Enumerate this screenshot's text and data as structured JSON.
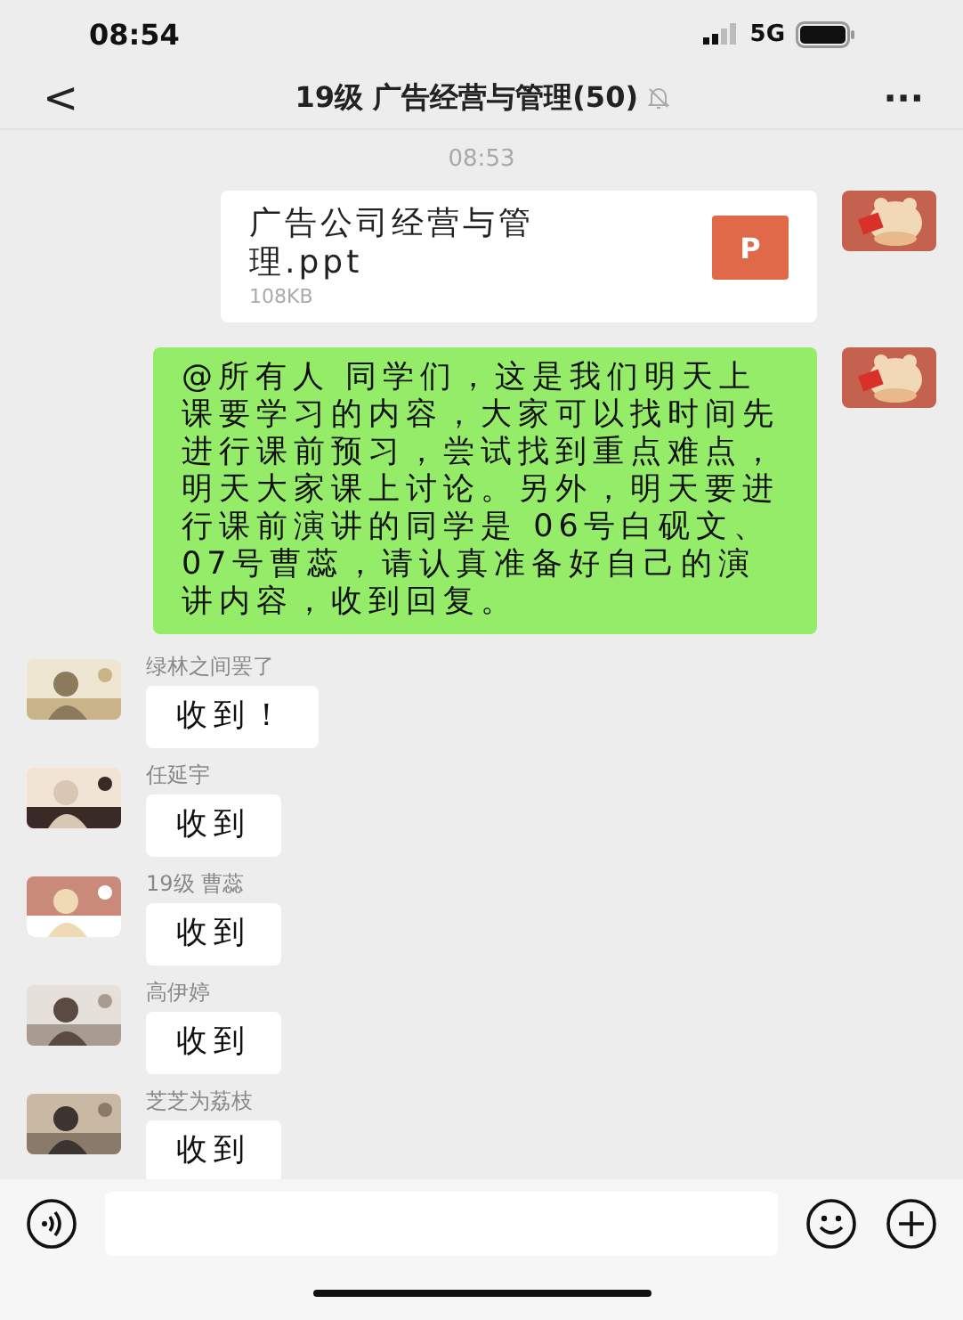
{
  "status_bar": {
    "time": "08:54",
    "network": "5G"
  },
  "nav": {
    "back": "<",
    "title": "19级 广告经营与管理(50)",
    "muted": true,
    "more": "···"
  },
  "timestamp": "08:53",
  "messages": [
    {
      "kind": "file",
      "outgoing": true,
      "file_name": "广告公司经营与管理.ppt",
      "file_size": "108KB",
      "file_icon": "P"
    },
    {
      "kind": "text",
      "outgoing": true,
      "text": "@所有人 同学们，这是我们明天上课要学习的内容，大家可以找时间先进行课前预习，尝试找到重点难点，明天大家课上讨论。另外，明天要进行课前演讲的同学是 06号白砚文、07号曹蕊，请认真准备好自己的演讲内容，收到回复。"
    },
    {
      "kind": "text",
      "outgoing": false,
      "sender": "绿林之间罢了",
      "text": "收到！"
    },
    {
      "kind": "text",
      "outgoing": false,
      "sender": "任延宇",
      "text": "收到"
    },
    {
      "kind": "text",
      "outgoing": false,
      "sender": "19级 曹蕊",
      "text": "收到"
    },
    {
      "kind": "text",
      "outgoing": false,
      "sender": "高伊婷",
      "text": "收到"
    },
    {
      "kind": "text",
      "outgoing": false,
      "sender": "芝芝为荔枝",
      "text": "收到"
    }
  ]
}
